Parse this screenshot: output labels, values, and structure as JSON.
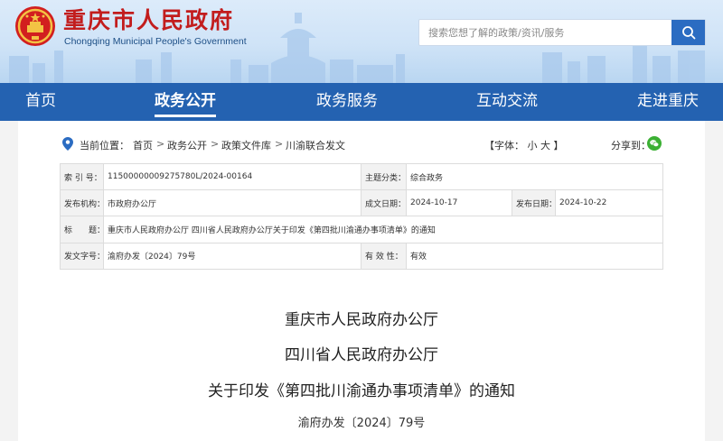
{
  "header": {
    "title": "重庆市人民政府",
    "subtitle": "Chongqing Municipal People's Government",
    "search_placeholder": "搜索您想了解的政策/资讯/服务"
  },
  "nav": {
    "items": [
      "首页",
      "政务公开",
      "政务服务",
      "互动交流",
      "走进重庆"
    ],
    "active": "政务公开"
  },
  "breadcrumb": {
    "label": "当前位置：",
    "items": [
      "首页",
      "政务公开",
      "政策文件库",
      "川渝联合发文"
    ],
    "separator": ">"
  },
  "font_size": {
    "label": "【字体：",
    "small": "小",
    "large": "大",
    "close": "】"
  },
  "share": {
    "label": "分享到："
  },
  "meta": {
    "index_label": "索 引 号：",
    "index_value": "11500000009275780L/2024-00164",
    "category_label": "主题分类：",
    "category_value": "综合政务",
    "issuer_label": "发布机构：",
    "issuer_value": "市政府办公厅",
    "written_label": "成文日期：",
    "written_value": "2024-10-17",
    "published_label": "发布日期：",
    "published_value": "2024-10-22",
    "title_label": "标　　题：",
    "title_value": "重庆市人民政府办公厅 四川省人民政府办公厅关于印发《第四批川渝通办事项清单》的通知",
    "docno_label": "发文字号：",
    "docno_value": "渝府办发〔2024〕79号",
    "validity_label": "有 效 性：",
    "validity_value": "有效"
  },
  "document": {
    "issuer_1": "重庆市人民政府办公厅",
    "issuer_2": "四川省人民政府办公厅",
    "title": "关于印发《第四批川渝通办事项清单》的通知",
    "doc_number": "渝府办发〔2024〕79号"
  },
  "colors": {
    "nav_bg": "#2462b1",
    "title_red": "#c21d1d",
    "wechat_green": "#3cb034",
    "location_blue": "#2b6cc2"
  }
}
